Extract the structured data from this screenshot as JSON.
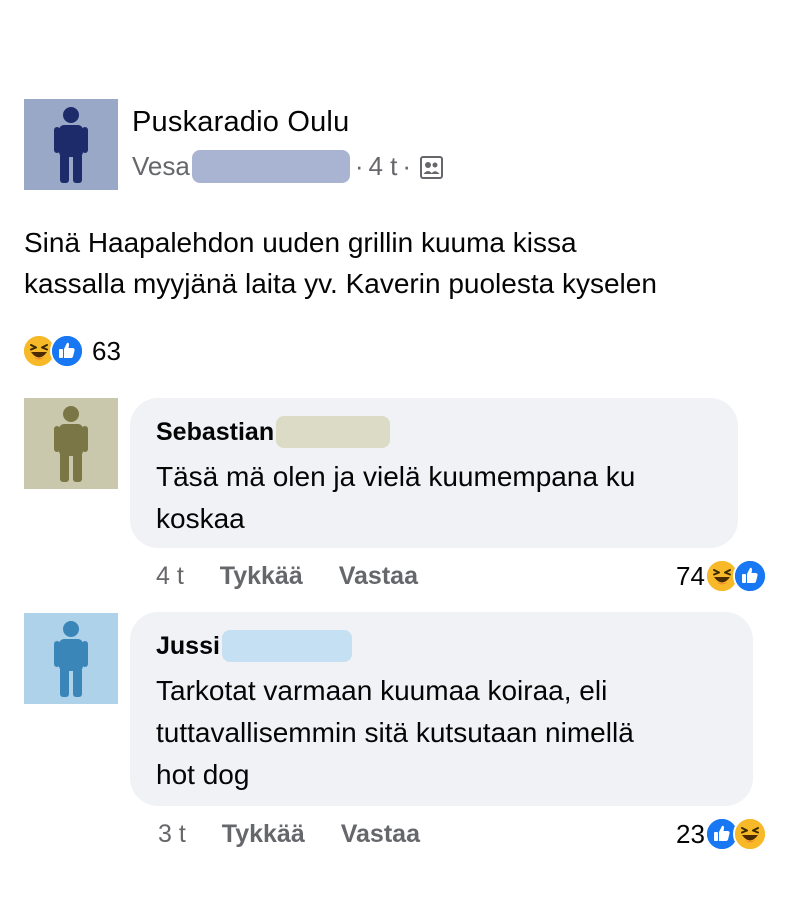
{
  "post": {
    "group_name": "Puskaradio Oulu",
    "author_first_name": "Vesa",
    "separator": "·",
    "time": "4 t",
    "text_line_1": "Sinä Haapalehdon uuden grillin kuuma kissa",
    "text_line_2": "kassalla myyjänä  laita yv. Kaverin puolesta kyselen",
    "reaction_count": "63",
    "reactions": [
      "laugh-icon",
      "like-icon"
    ],
    "privacy_icon": "members-icon",
    "avatar_color": "#9aa8c8",
    "redaction_color": "#a9b4d2"
  },
  "comments": [
    {
      "author_first_name": "Sebastian",
      "text_line_1": "Täsä mä olen ja vielä kuumempana ku",
      "text_line_2": "koskaa",
      "time": "4 t",
      "like_label": "Tykkää",
      "reply_label": "Vastaa",
      "reaction_count": "74",
      "reactions": [
        "laugh-icon",
        "like-icon"
      ],
      "avatar_color": "#c9c8ad",
      "redaction_color": "#dcdbc6"
    },
    {
      "author_first_name": "Jussi",
      "text_line_1": "Tarkotat varmaan kuumaa koiraa, eli",
      "text_line_2": "tuttavallisemmin sitä kutsutaan nimellä",
      "text_line_3": "hot dog",
      "time": "3 t",
      "like_label": "Tykkää",
      "reply_label": "Vastaa",
      "reaction_count": "23",
      "reactions": [
        "like-icon",
        "laugh-icon"
      ],
      "avatar_color": "#aed2ea",
      "redaction_color": "#c5e0f2"
    }
  ],
  "colors": {
    "like_blue": "#1877f2",
    "laugh_yellow": "#f7b928",
    "meta_gray": "#65676b",
    "bubble_bg": "#f0f2f5"
  }
}
